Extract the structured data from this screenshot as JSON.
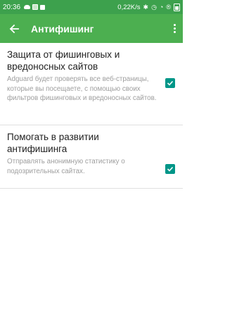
{
  "status_bar": {
    "time": "20:36",
    "speed": "0,22K/s",
    "battery_icon": "battery-icon",
    "color": "#3da14d"
  },
  "app_bar": {
    "title": "Антифишинг",
    "back_icon": "arrow-back-icon",
    "menu_icon": "more-vert-icon",
    "color": "#4caf50"
  },
  "settings": [
    {
      "title": "Защита от фишинговых и вредоносных сайтов",
      "description": "Adguard будет проверять все веб-страницы, которые вы посещаете, с помощью своих фильтров фишинговых и вредоносных сайтов.",
      "checked": true
    },
    {
      "title": "Помогать в развитии антифишинга",
      "description": "Отправлять анонимную статистику о подозрительных сайтах.",
      "checked": true
    }
  ],
  "accent_color": "#009688"
}
